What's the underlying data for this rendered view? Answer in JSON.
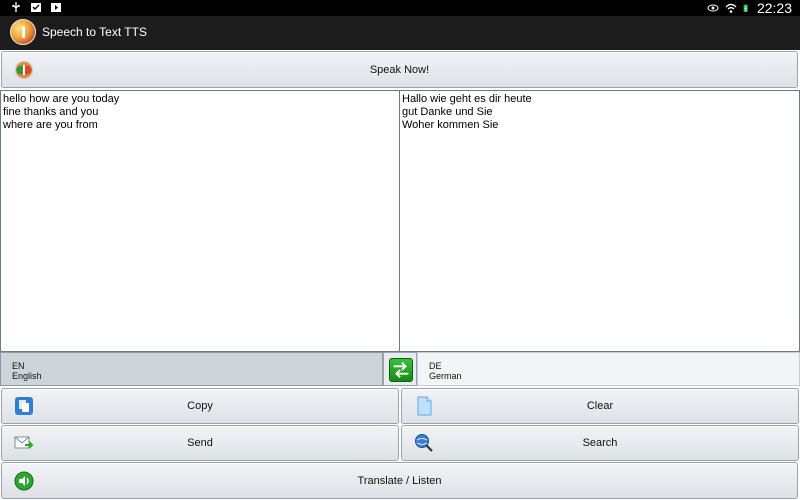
{
  "status_bar": {
    "time": "22:23",
    "left_icons": [
      "usb-icon",
      "download-done-icon",
      "play-store-icon"
    ],
    "right_icons": [
      "eye-icon",
      "wifi-icon",
      "battery-charging-icon"
    ]
  },
  "app": {
    "title": "Speech to Text TTS"
  },
  "speak_button": {
    "label": "Speak Now!",
    "icon": "mic-logo-icon"
  },
  "source_text": {
    "lines": [
      "hello how are you today",
      "fine thanks and you",
      "where are you from"
    ]
  },
  "target_text": {
    "lines": [
      "Hallo wie geht es dir heute",
      "gut Danke und Sie",
      "Woher kommen Sie"
    ]
  },
  "source_language": {
    "code": "EN",
    "name": "English"
  },
  "target_language": {
    "code": "DE",
    "name": "German"
  },
  "actions": {
    "copy": "Copy",
    "clear": "Clear",
    "send": "Send",
    "search": "Search",
    "translate": "Translate / Listen"
  },
  "colors": {
    "action_bar": "#1c1c1c",
    "status_bar": "#000000",
    "selected_language_bg": "#cdd4da",
    "swap_green": "#2ea52e"
  }
}
